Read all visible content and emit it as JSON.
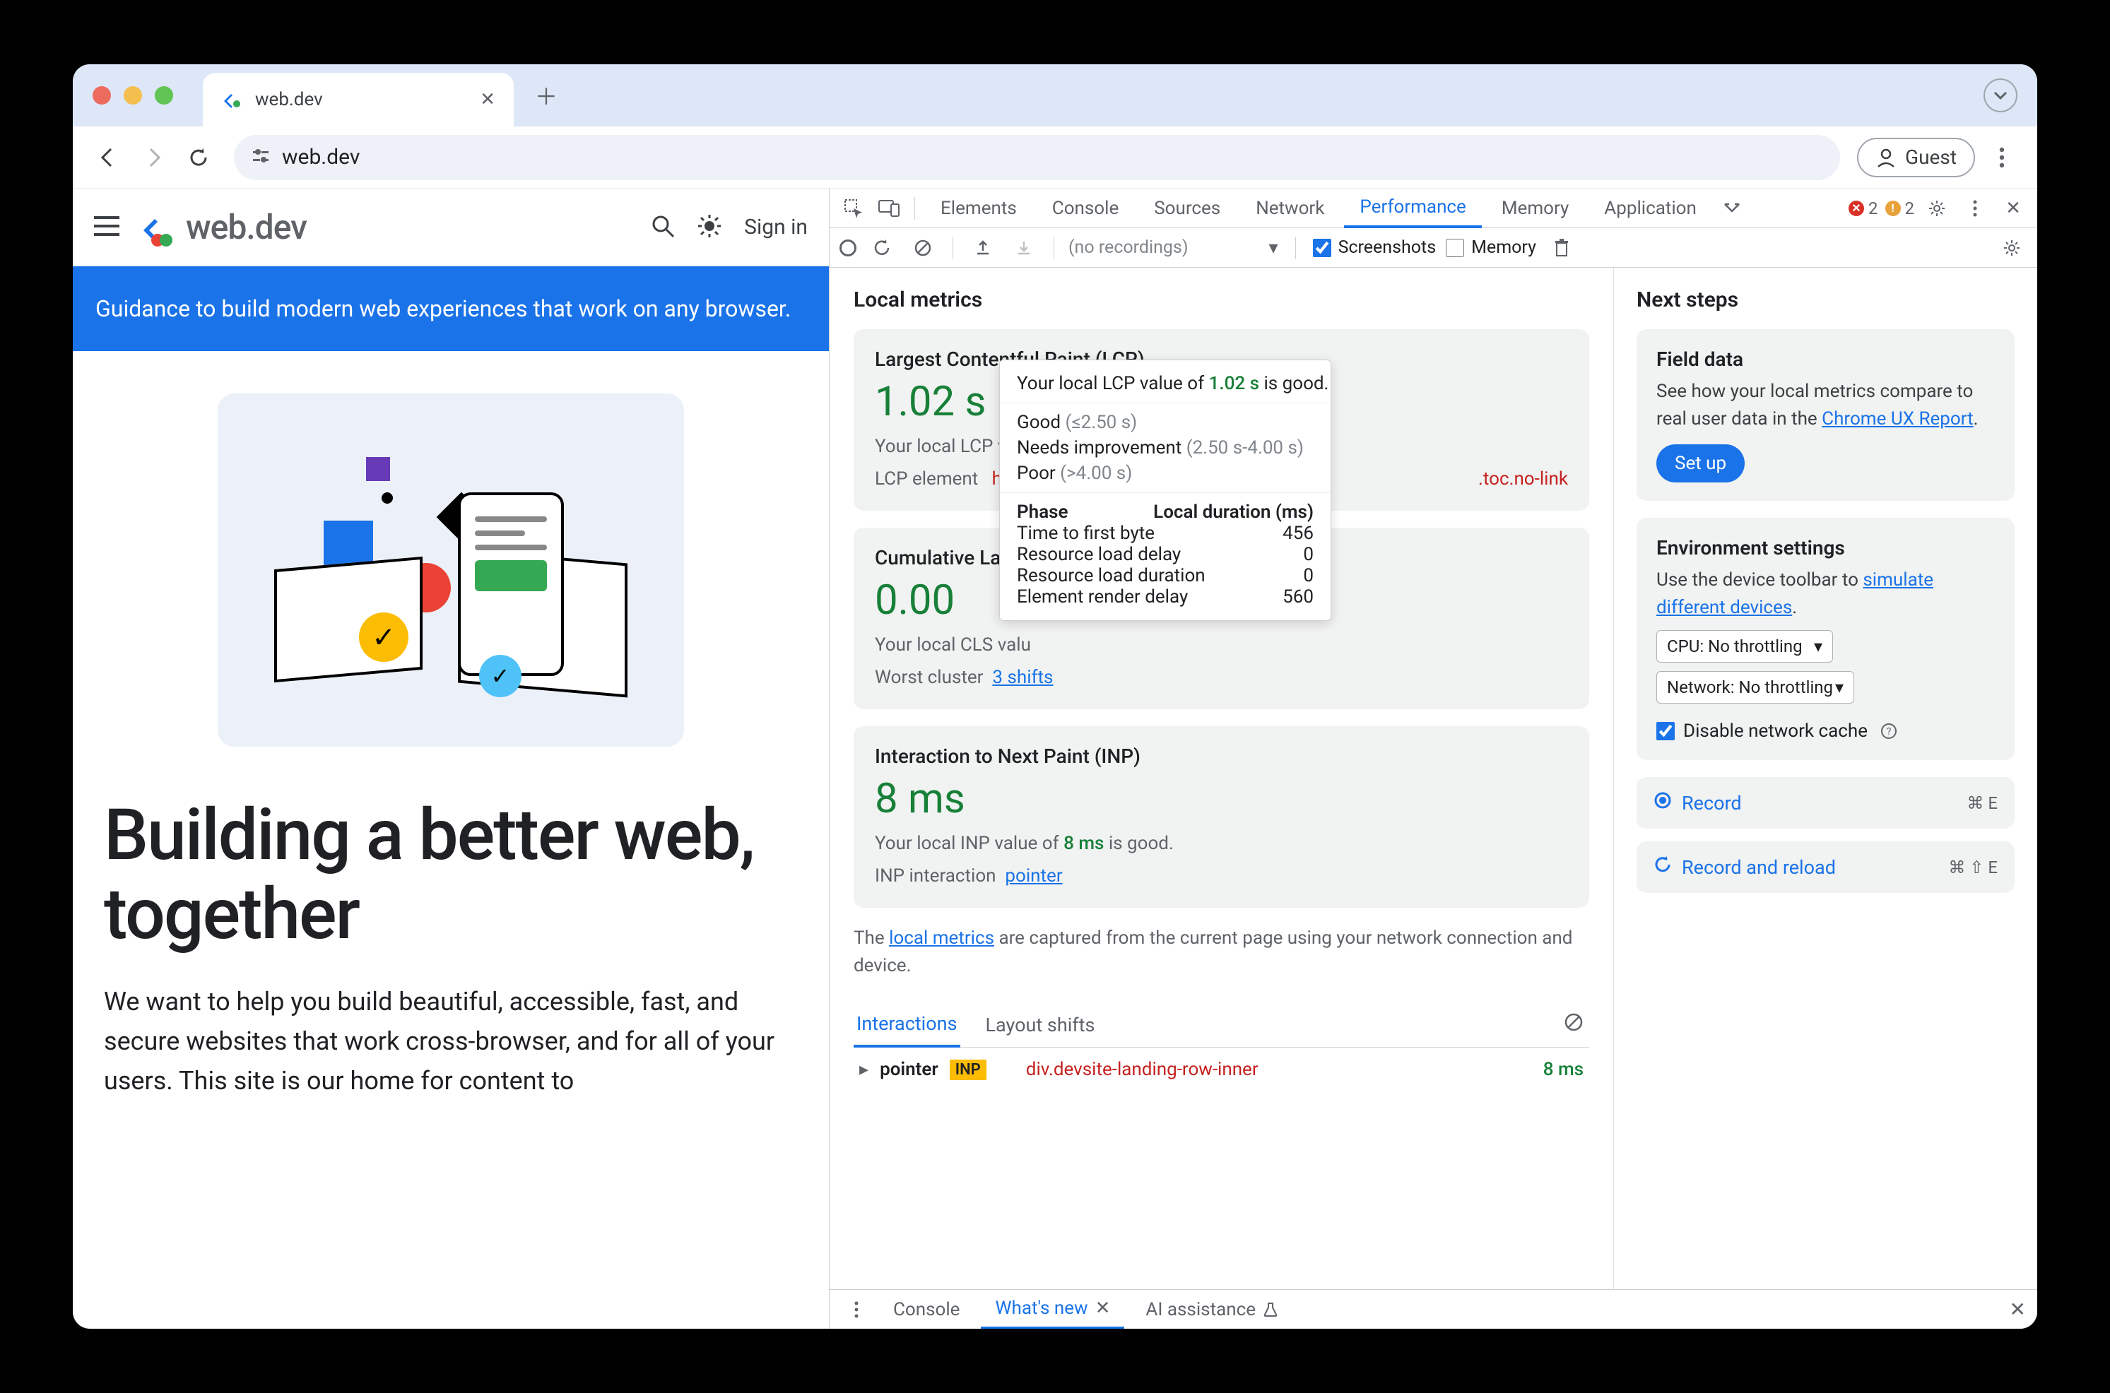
{
  "browser": {
    "tab_title": "web.dev",
    "url": "web.dev",
    "guest_label": "Guest"
  },
  "page": {
    "brand": "web.dev",
    "signin": "Sign in",
    "banner": "Guidance to build modern web experiences that work on any browser.",
    "headline": "Building a better web, together",
    "body": "We want to help you build beautiful, accessible, fast, and secure websites that work cross-browser, and for all of your users. This site is our home for content to"
  },
  "devtools": {
    "tabs": [
      "Elements",
      "Console",
      "Sources",
      "Network",
      "Performance",
      "Memory",
      "Application"
    ],
    "active_tab": "Performance",
    "error_count": "2",
    "warning_count": "2",
    "no_recordings": "(no recordings)",
    "screenshots_label": "Screenshots",
    "memory_label": "Memory",
    "local_metrics_title": "Local metrics",
    "lcp": {
      "name": "Largest Contentful Paint (LCP)",
      "value": "1.02 s",
      "descA": "Your local LCP valu",
      "elem_label": "LCP element",
      "elem_value": "h3#b",
      "toc": ".toc.no-link"
    },
    "tooltip": {
      "intro_a": "Your local LCP value of ",
      "intro_val": "1.02 s",
      "intro_b": " is good.",
      "good_label": "Good",
      "good_thresh": "(≤2.50 s)",
      "ni_label": "Needs improvement",
      "ni_thresh": "(2.50 s-4.00 s)",
      "poor_label": "Poor",
      "poor_thresh": "(>4.00 s)",
      "phase_head": "Phase",
      "dur_head": "Local duration (ms)",
      "rows": [
        {
          "label": "Time to first byte",
          "value": "456"
        },
        {
          "label": "Resource load delay",
          "value": "0"
        },
        {
          "label": "Resource load duration",
          "value": "0"
        },
        {
          "label": "Element render delay",
          "value": "560"
        }
      ]
    },
    "cls": {
      "name": "Cumulative Layo",
      "value": "0.00",
      "desc": "Your local CLS valu",
      "worst_label": "Worst cluster",
      "worst_link": "3 shifts"
    },
    "inp": {
      "name": "Interaction to Next Paint (INP)",
      "value": "8 ms",
      "descA": "Your local INP value of ",
      "descVal": "8 ms",
      "descB": " is good.",
      "int_label": "INP interaction",
      "int_link": "pointer"
    },
    "footnoteA": "The ",
    "footnoteLink": "local metrics",
    "footnoteB": " are captured from the current page using your network connection and device.",
    "subtabs": {
      "interactions": "Interactions",
      "layout": "Layout shifts"
    },
    "interaction": {
      "type": "pointer",
      "badge": "INP",
      "element": "div.devsite-landing-row-inner",
      "time": "8 ms"
    },
    "next_steps_title": "Next steps",
    "field_data": {
      "title": "Field data",
      "textA": "See how your local metrics compare to real user data in the ",
      "link": "Chrome UX Report",
      "setup": "Set up"
    },
    "env": {
      "title": "Environment settings",
      "textA": "Use the device toolbar to ",
      "link": "simulate different devices",
      "cpu": "CPU: No throttling",
      "net": "Network: No throttling",
      "disable_cache": "Disable network cache"
    },
    "actions": {
      "record": "Record",
      "record_kbd": "⌘ E",
      "reload": "Record and reload",
      "reload_kbd": "⌘ ⇧ E"
    },
    "drawer": {
      "console": "Console",
      "whatsnew": "What's new",
      "ai": "AI assistance"
    }
  }
}
